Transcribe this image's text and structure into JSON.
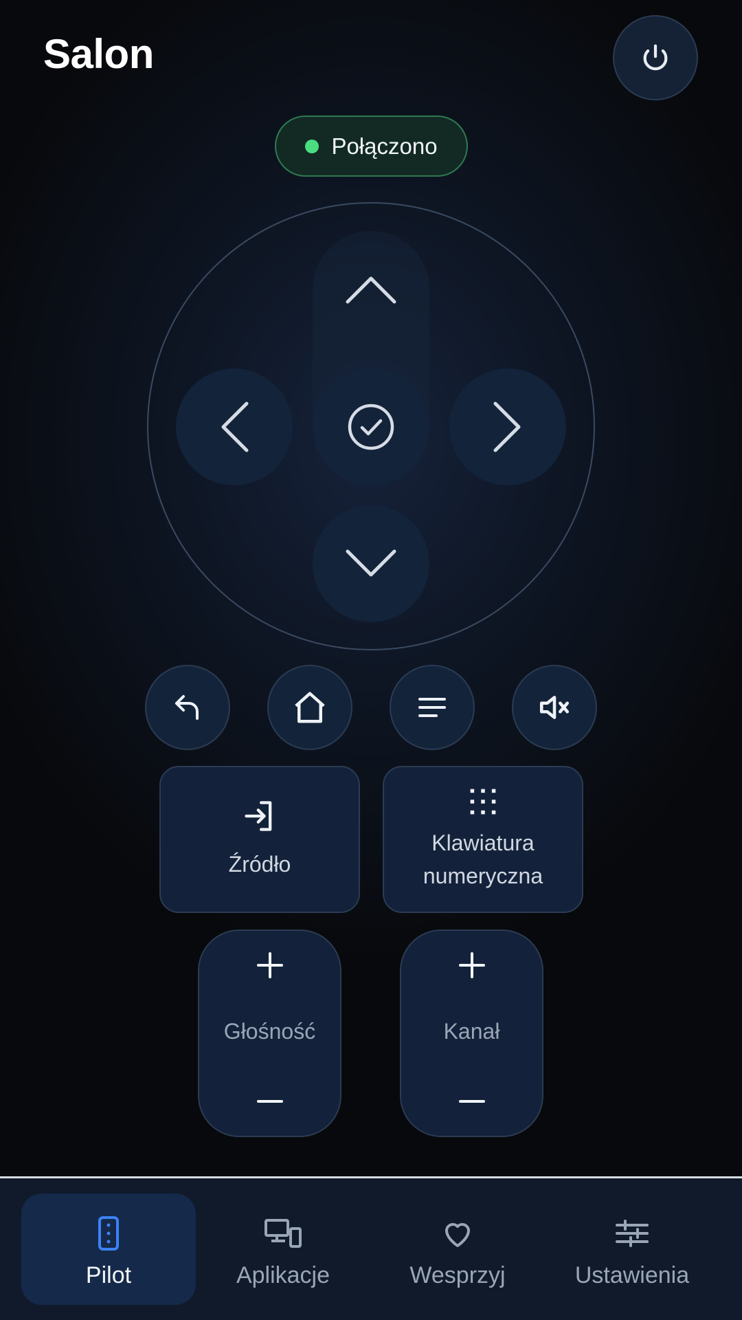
{
  "header": {
    "title": "Salon",
    "power_icon": "power-icon"
  },
  "status": {
    "text": "Połączono",
    "color": "#4ade80"
  },
  "dpad": {
    "up_icon": "chevron-up-icon",
    "down_icon": "chevron-down-icon",
    "left_icon": "chevron-left-icon",
    "right_icon": "chevron-right-icon",
    "ok_icon": "check-circle-icon"
  },
  "controls": [
    {
      "name": "back",
      "icon": "back-arrow-icon"
    },
    {
      "name": "home",
      "icon": "home-icon"
    },
    {
      "name": "menu",
      "icon": "menu-icon"
    },
    {
      "name": "mute",
      "icon": "mute-icon"
    }
  ],
  "cards": {
    "source": {
      "label": "Źródło",
      "icon": "input-source-icon"
    },
    "numpad": {
      "label_line1": "Klawiatura",
      "label_line2": "numeryczna",
      "icon": "keypad-icon"
    }
  },
  "rockers": {
    "volume": {
      "label": "Głośność",
      "plus": "+",
      "minus": "–"
    },
    "channel": {
      "label": "Kanał",
      "plus": "+",
      "minus": "–"
    }
  },
  "nav": {
    "active": "Pilot",
    "accent": "#3b82f6",
    "items": [
      {
        "label": "Pilot",
        "icon": "remote-icon"
      },
      {
        "label": "Aplikacje",
        "icon": "devices-icon"
      },
      {
        "label": "Wesprzyj",
        "icon": "heart-icon"
      },
      {
        "label": "Ustawienia",
        "icon": "sliders-icon"
      }
    ]
  }
}
